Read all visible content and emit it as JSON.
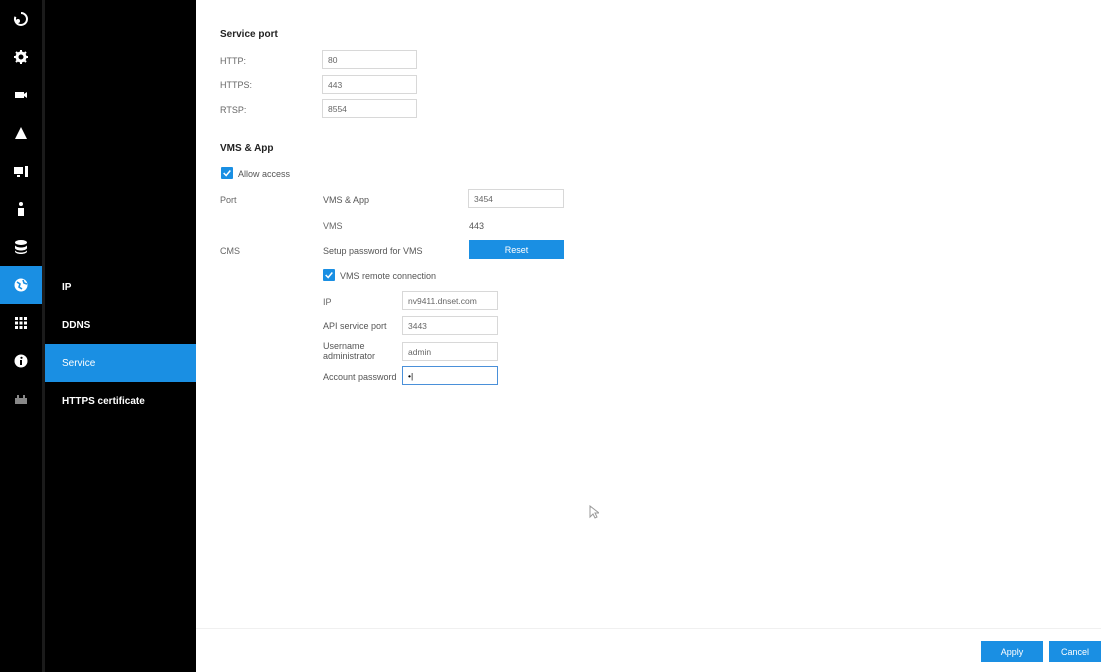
{
  "rail": {
    "icons": [
      "refresh-icon",
      "gear-icon",
      "camera-icon",
      "alert-icon",
      "monitor-icon",
      "person-icon",
      "database-icon",
      "network-icon",
      "apps-icon",
      "info-icon",
      "plugin-icon"
    ],
    "active_index": 7
  },
  "submenu": {
    "items": [
      {
        "label": "IP"
      },
      {
        "label": "DDNS"
      },
      {
        "label": "Service"
      },
      {
        "label": "HTTPS certificate"
      }
    ],
    "active_index": 2
  },
  "service_port": {
    "title": "Service port",
    "http_label": "HTTP:",
    "http_value": "80",
    "https_label": "HTTPS:",
    "https_value": "443",
    "rtsp_label": "RTSP:",
    "rtsp_value": "8554"
  },
  "vms": {
    "title": "VMS & App",
    "allow_access_label": "Allow access",
    "allow_access_checked": true,
    "port_label": "Port",
    "vms_app_label": "VMS & App",
    "vms_app_value": "3454",
    "vms_label": "VMS",
    "vms_value": "443",
    "cms_label": "CMS",
    "setup_password_label": "Setup password for VMS",
    "reset_label": "Reset",
    "remote_label": "VMS remote connection",
    "remote_checked": true,
    "ip_label": "IP",
    "ip_value": "nv9411.dnset.com",
    "api_label": "API service port",
    "api_value": "3443",
    "username_label_1": "Username",
    "username_label_2": "administrator",
    "username_value": "admin",
    "password_label": "Account password",
    "password_value": "•|"
  },
  "footer": {
    "apply_label": "Apply",
    "cancel_label": "Cancel"
  },
  "colors": {
    "accent": "#1a8fe3",
    "sidebar": "#000000"
  }
}
